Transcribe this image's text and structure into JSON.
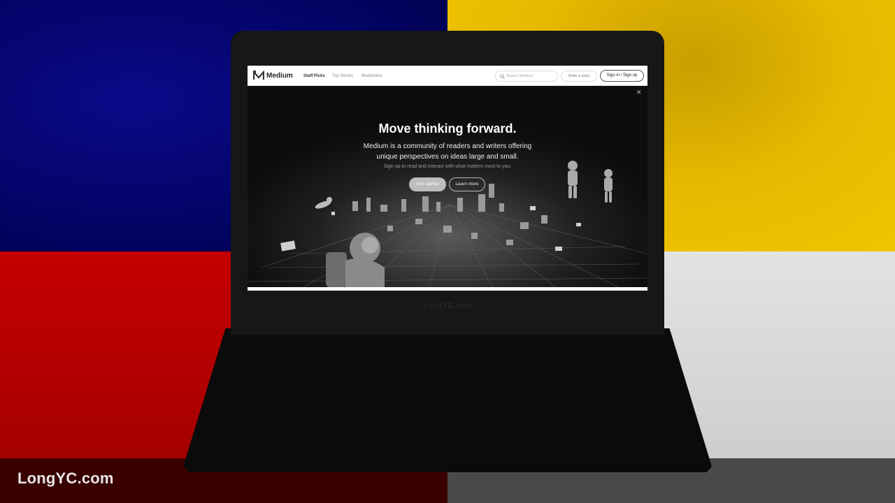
{
  "watermark": {
    "corner": "LongYC.com",
    "laptop": "LongYC.com"
  },
  "colors": {
    "blue": "#02025e",
    "yellow": "#e6b800",
    "red": "#b00000",
    "grey": "#d4d4d4",
    "laptop": "#171717"
  },
  "app": {
    "brand": "Medium",
    "logo_icon": "medium-logo-icon",
    "nav_links": [
      "Staff Picks",
      "Top Stories",
      "Bookmarks"
    ],
    "search_placeholder": "Search Medium",
    "search_icon": "search-icon",
    "write_label": "Write a story",
    "sign_label": "Sign in / Sign up"
  },
  "hero": {
    "title": "Move thinking forward.",
    "subtitle_line1": "Medium is a community of readers and writers offering",
    "subtitle_line2": "unique perspectives on ideas large and small.",
    "note": "Sign up to read and interact with what matters most to you.",
    "primary_button": "Get started",
    "secondary_button": "Learn more",
    "close_icon": "close-icon"
  }
}
